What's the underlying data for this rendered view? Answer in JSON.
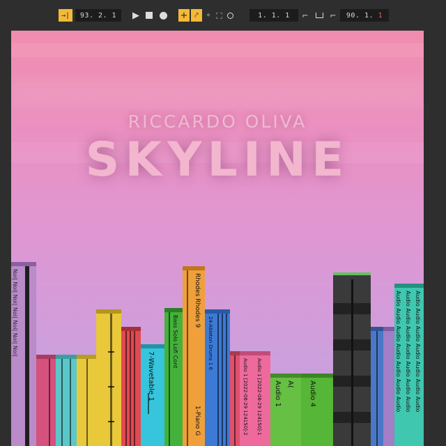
{
  "transport": {
    "arrangement_position": "93.  2.  1",
    "loop_start": "1.  1.  1",
    "tempo_display": "90.  1.",
    "tempo_last_digit": "1",
    "icons": {
      "follow": "follow-arrow-icon",
      "play": "play-icon",
      "stop": "stop-icon",
      "record": "record-icon",
      "overdub": "overdub-plus-icon",
      "automation_arm": "automation-arm-icon",
      "draw": "draw-mode-icon",
      "capture": "capture-icon",
      "session_record": "session-record-icon",
      "punch_in": "punch-in-icon",
      "loop": "loop-icon",
      "punch_out": "punch-out-icon"
    }
  },
  "artwork": {
    "artist": "RICCARDO OLIVA",
    "title": "SKYLINE",
    "clip_labels": {
      "noise": "Noi| Noi| Noi| Noi| Noi| Noi| Noi|",
      "wavetable": "7-Wavetable 1",
      "bass": "Bass Solo Lofi Cont",
      "rhodes": "Rhodes Rhodes 9",
      "piano": "1-Piano G",
      "ableton_drums": "24-Ableton Drums 1 6",
      "audio_recording_a": "Audio 1 [2022-08-29 124150]-2",
      "audio_recording_b": "Audio 1 [2022-08-29 124150]-1",
      "audio1": "Audio 1",
      "audio_a": "A(",
      "audio4": "Audio 4",
      "audio_repeat": "Audio Audio Audio Audio Audio Audio Audio"
    },
    "colors": {
      "sky_top": "#f08dae",
      "sky_bottom": "#c3a2de",
      "title": "#f2b6cf",
      "transport_active": "#f3b937"
    }
  }
}
